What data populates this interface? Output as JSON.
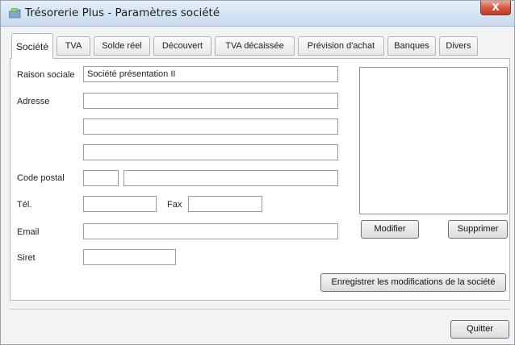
{
  "window": {
    "title": "Trésorerie Plus - Paramètres société",
    "close_label": "X",
    "app_icon": "folder-cash-icon"
  },
  "tabs": [
    {
      "label": "Société",
      "active": true
    },
    {
      "label": "TVA"
    },
    {
      "label": "Solde réel"
    },
    {
      "label": "Découvert"
    },
    {
      "label": "TVA décaissée"
    },
    {
      "label": "Prévision d'achat"
    },
    {
      "label": "Banques"
    },
    {
      "label": "Divers"
    }
  ],
  "form": {
    "raison_sociale_label": "Raison sociale",
    "raison_sociale_value": "Société présentation II",
    "adresse_label": "Adresse",
    "adresse1_value": "",
    "adresse2_value": "",
    "adresse3_value": "",
    "code_postal_label": "Code postal",
    "code_postal_value": "",
    "ville_value": "",
    "tel_label": "Tél.",
    "tel_value": "",
    "fax_label": "Fax",
    "fax_value": "",
    "email_label": "Email",
    "email_value": "",
    "siret_label": "Siret",
    "siret_value": ""
  },
  "logo": {
    "modifier_label": "Modifier",
    "supprimer_label": "Supprimer"
  },
  "save_label": "Enregistrer les modifications de la société",
  "quit_label": "Quitter"
}
